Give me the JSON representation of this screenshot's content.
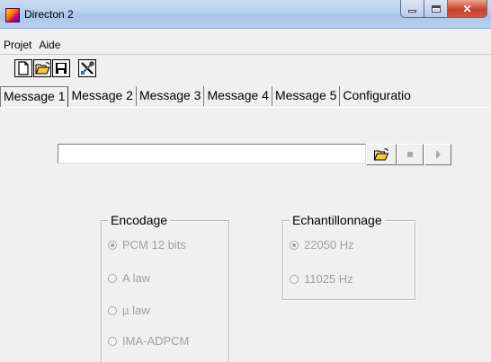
{
  "window": {
    "title": "Directon 2",
    "close_glyph": "✕"
  },
  "menu": [
    {
      "label": "Projet"
    },
    {
      "label": "Aide"
    }
  ],
  "toolbar": {
    "icons": [
      "new-file-icon",
      "open-folder-icon",
      "save-icon",
      "settings-tools-icon"
    ]
  },
  "tabs": [
    {
      "label": "Message 1",
      "active": true
    },
    {
      "label": "Message 2"
    },
    {
      "label": "Message 3"
    },
    {
      "label": "Message 4"
    },
    {
      "label": "Message 5"
    },
    {
      "label": "Configuratio"
    }
  ],
  "file_row": {
    "path_value": "",
    "buttons": [
      "open-folder-icon",
      "stop-icon",
      "play-icon"
    ]
  },
  "encodage": {
    "title": "Encodage",
    "options": [
      {
        "label": "PCM 12 bits",
        "checked": true
      },
      {
        "label": "A law",
        "checked": false
      },
      {
        "label": "µ law",
        "checked": false
      },
      {
        "label": "IMA-ADPCM",
        "checked": false
      }
    ]
  },
  "echantillonnage": {
    "title": "Echantillonnage",
    "options": [
      {
        "label": "22050 Hz",
        "checked": true
      },
      {
        "label": "11025 Hz",
        "checked": false
      }
    ]
  },
  "colors": {
    "disabled_text": "#a0a0a0",
    "window_bg": "#f0f0f0"
  }
}
